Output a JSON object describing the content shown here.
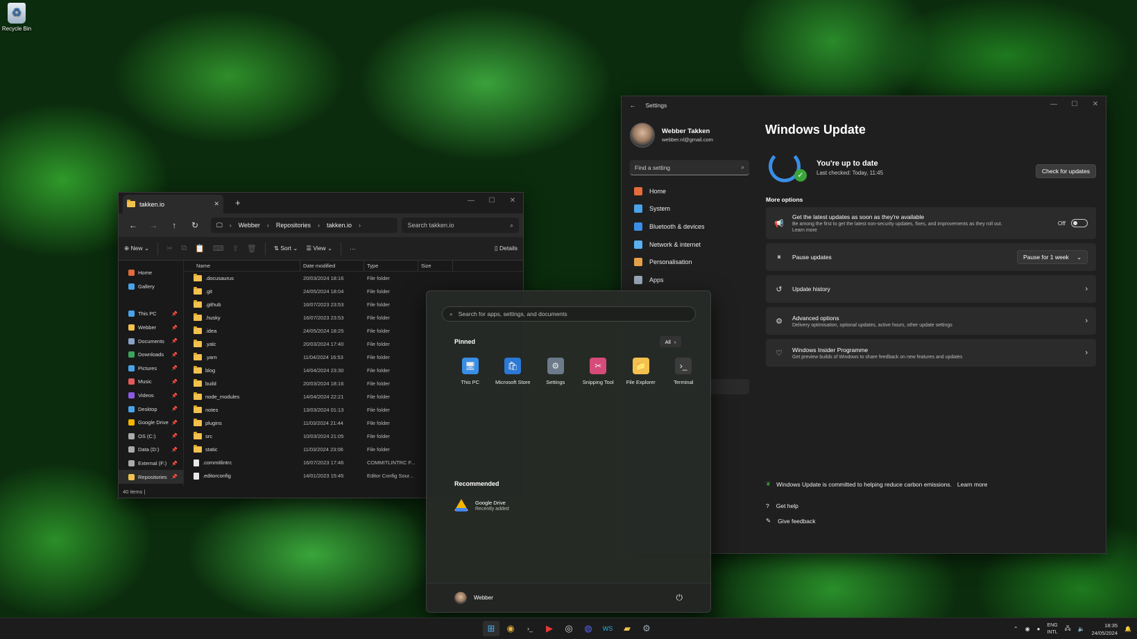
{
  "desktop": {
    "recycle_bin_label": "Recycle Bin"
  },
  "explorer": {
    "tab_title": "takken.io",
    "breadcrumbs": [
      "Webber",
      "Repositories",
      "takken.io"
    ],
    "search_placeholder": "Search takken.io",
    "toolbar": {
      "new_label": "New",
      "sort_label": "Sort",
      "view_label": "View",
      "more_label": "···",
      "details_label": "Details"
    },
    "sidebar": [
      {
        "label": "Home",
        "icon": "home-icon",
        "color": "#e36b3c"
      },
      {
        "label": "Gallery",
        "icon": "gallery-icon",
        "color": "#4aa3e8"
      },
      {
        "label": "This PC",
        "icon": "pc-icon",
        "color": "#4aa3e8",
        "pinned": true
      },
      {
        "label": "Webber",
        "icon": "folder-icon",
        "color": "#f2c14e",
        "pinned": true
      },
      {
        "label": "Documents",
        "icon": "documents-icon",
        "color": "#8aa4c8",
        "pinned": true
      },
      {
        "label": "Downloads",
        "icon": "downloads-icon",
        "color": "#3aa55a",
        "pinned": true
      },
      {
        "label": "Pictures",
        "icon": "pictures-icon",
        "color": "#4aa3e8",
        "pinned": true
      },
      {
        "label": "Music",
        "icon": "music-icon",
        "color": "#e35a5a",
        "pinned": true
      },
      {
        "label": "Videos",
        "icon": "videos-icon",
        "color": "#8b5ae3",
        "pinned": true
      },
      {
        "label": "Desktop",
        "icon": "desktop-icon",
        "color": "#4aa3e8",
        "pinned": true
      },
      {
        "label": "Google Drive",
        "icon": "google-drive-icon",
        "color": "#f4b400",
        "pinned": true
      },
      {
        "label": "OS (C:)",
        "icon": "drive-icon",
        "color": "#aaaaaa",
        "pinned": true
      },
      {
        "label": "Data (D:)",
        "icon": "drive-icon",
        "color": "#aaaaaa",
        "pinned": true
      },
      {
        "label": "External (F:)",
        "icon": "drive-icon",
        "color": "#aaaaaa",
        "pinned": true
      },
      {
        "label": "Repositories",
        "icon": "folder-icon",
        "color": "#f2c14e",
        "pinned": true,
        "selected": true
      }
    ],
    "columns": [
      "Name",
      "Date modified",
      "Type",
      "Size"
    ],
    "rows": [
      {
        "name": ".docusaurus",
        "date": "20/03/2024 18:16",
        "type": "File folder",
        "kind": "folder"
      },
      {
        "name": ".git",
        "date": "24/05/2024 18:04",
        "type": "File folder",
        "kind": "folder"
      },
      {
        "name": ".github",
        "date": "16/07/2023 23:53",
        "type": "File folder",
        "kind": "folder"
      },
      {
        "name": ".husky",
        "date": "16/07/2023 23:53",
        "type": "File folder",
        "kind": "folder"
      },
      {
        "name": ".idea",
        "date": "24/05/2024 18:25",
        "type": "File folder",
        "kind": "folder"
      },
      {
        "name": ".yalc",
        "date": "20/03/2024 17:40",
        "type": "File folder",
        "kind": "folder"
      },
      {
        "name": ".yarn",
        "date": "11/04/2024 16:53",
        "type": "File folder",
        "kind": "folder"
      },
      {
        "name": "blog",
        "date": "14/04/2024 23:30",
        "type": "File folder",
        "kind": "folder"
      },
      {
        "name": "build",
        "date": "20/03/2024 18:16",
        "type": "File folder",
        "kind": "folder"
      },
      {
        "name": "node_modules",
        "date": "14/04/2024 22:21",
        "type": "File folder",
        "kind": "folder"
      },
      {
        "name": "notes",
        "date": "13/03/2024 01:13",
        "type": "File folder",
        "kind": "folder"
      },
      {
        "name": "plugins",
        "date": "11/03/2024 21:44",
        "type": "File folder",
        "kind": "folder"
      },
      {
        "name": "src",
        "date": "10/03/2024 21:05",
        "type": "File folder",
        "kind": "folder"
      },
      {
        "name": "static",
        "date": "11/03/2024 23:06",
        "type": "File folder",
        "kind": "folder"
      },
      {
        "name": ".commitlintrc",
        "date": "16/07/2023 17:46",
        "type": "COMMITLINTRC F...",
        "kind": "file"
      },
      {
        "name": ".editorconfig",
        "date": "14/01/2023 15:45",
        "type": "Editor Config Sour...",
        "kind": "file"
      }
    ],
    "status": "40 items"
  },
  "settings": {
    "title": "Settings",
    "user": {
      "name": "Webber Takken",
      "email": "webber.nl@gmail.com"
    },
    "search_placeholder": "Find a setting",
    "nav": [
      {
        "label": "Home",
        "icon": "home-icon",
        "color": "#e36b3c"
      },
      {
        "label": "System",
        "icon": "system-icon",
        "color": "#4aa3e8"
      },
      {
        "label": "Bluetooth & devices",
        "icon": "bluetooth-icon",
        "color": "#3a8ee6"
      },
      {
        "label": "Network & internet",
        "icon": "network-icon",
        "color": "#5ab0f0"
      },
      {
        "label": "Personalisation",
        "icon": "personalisation-icon",
        "color": "#e3a24a"
      },
      {
        "label": "Apps",
        "icon": "apps-icon",
        "color": "#9aa8b8"
      }
    ],
    "page_title": "Windows Update",
    "status_title": "You're up to date",
    "status_sub": "Last checked: Today, 11:45",
    "check_button": "Check for updates",
    "more_options": "More options",
    "latest": {
      "title": "Get the latest updates as soon as they're available",
      "desc": "Be among the first to get the latest non-security updates, fixes, and improvements as they roll out.",
      "link": "Learn more",
      "toggle_label": "Off"
    },
    "pause": {
      "title": "Pause updates",
      "value": "Pause for 1 week"
    },
    "history": {
      "title": "Update history"
    },
    "advanced": {
      "title": "Advanced options",
      "desc": "Delivery optimisation, optional updates, active hours, other update settings"
    },
    "insider": {
      "title": "Windows Insider Programme",
      "desc": "Get preview builds of Windows to share feedback on new features and updates"
    },
    "carbon": {
      "text": "Windows Update is committed to helping reduce carbon emissions.",
      "link": "Learn more"
    },
    "get_help": "Get help",
    "give_feedback": "Give feedback"
  },
  "start": {
    "search_placeholder": "Search for apps, settings, and documents",
    "pinned_label": "Pinned",
    "all_button": "All",
    "pinned": [
      {
        "label": "This PC",
        "icon": "pc-icon",
        "color": "#3a8ee6"
      },
      {
        "label": "Microsoft Store",
        "icon": "store-icon",
        "color": "#2b78d6"
      },
      {
        "label": "Settings",
        "icon": "settings-gear-icon",
        "color": "#6c7a89"
      },
      {
        "label": "Snipping Tool",
        "icon": "snipping-icon",
        "color": "#d64b7a"
      },
      {
        "label": "File Explorer",
        "icon": "folder-icon",
        "color": "#f2c14e"
      },
      {
        "label": "Terminal",
        "icon": "terminal-icon",
        "color": "#3c3c3c"
      }
    ],
    "recommended_label": "Recommended",
    "recommended": [
      {
        "title": "Google Drive",
        "subtitle": "Recently added"
      }
    ],
    "user_name": "Webber"
  },
  "taskbar": {
    "apps": [
      "start-icon",
      "chrome-icon",
      "terminal-icon",
      "youtube-music-icon",
      "obs-icon",
      "discord-icon",
      "webstorm-icon",
      "file-explorer-icon",
      "settings-gear-icon"
    ],
    "lang_top": "ENG",
    "lang_bottom": "INTL",
    "time": "18:35",
    "date": "24/05/2024"
  }
}
